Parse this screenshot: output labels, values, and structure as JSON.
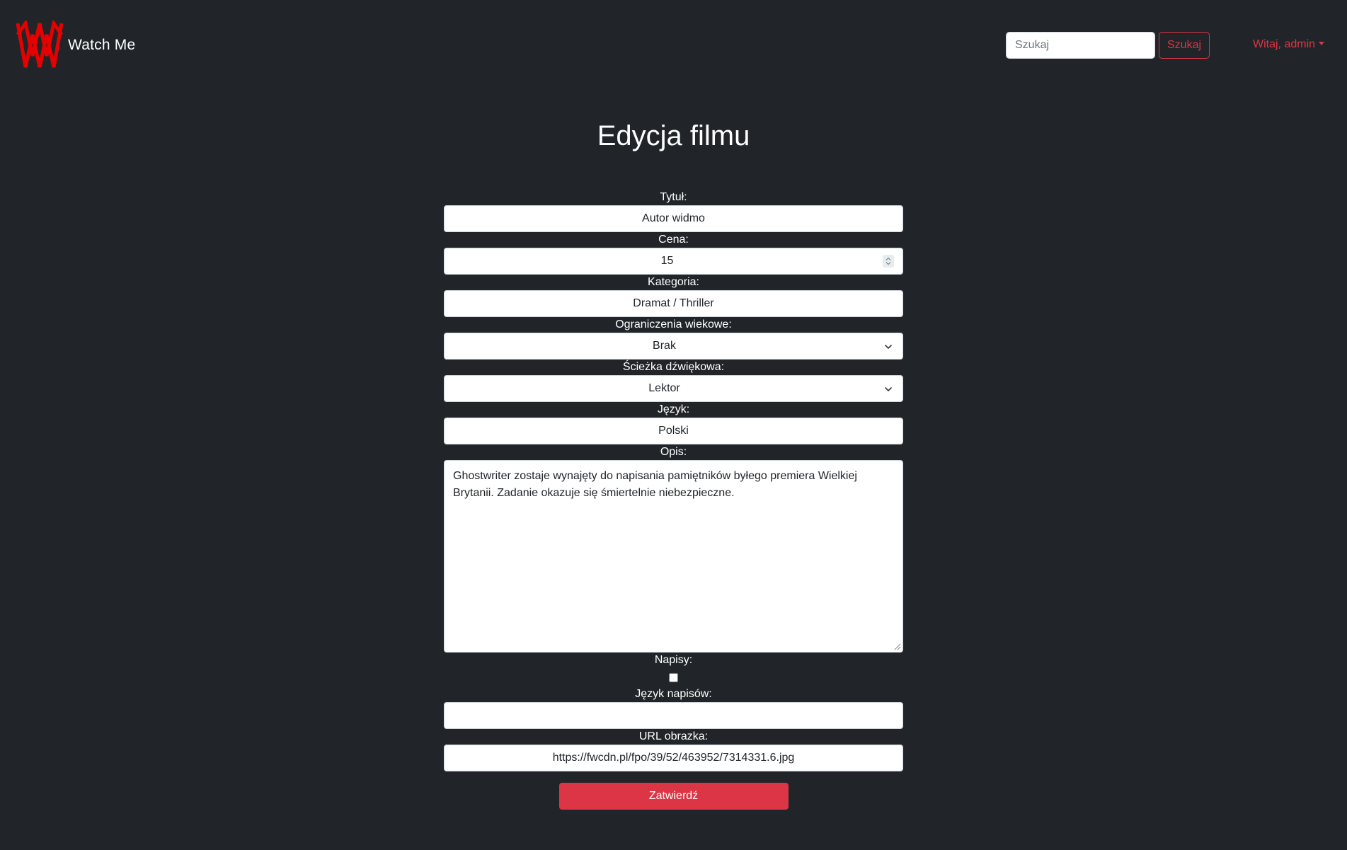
{
  "brand": {
    "name": "Watch Me",
    "logo_icon": "watch-me-logo-icon",
    "logo_color": "#e60000"
  },
  "search": {
    "placeholder": "Szukaj",
    "button_label": "Szukaj"
  },
  "user_menu": {
    "label": "Witaj, admin"
  },
  "colors": {
    "background": "#212529",
    "accent": "#dc3545",
    "text": "#ffffff"
  },
  "page": {
    "title": "Edycja filmu"
  },
  "form": {
    "title": {
      "label": "Tytuł:",
      "value": "Autor widmo"
    },
    "price": {
      "label": "Cena:",
      "value": "15"
    },
    "category": {
      "label": "Kategoria:",
      "value": "Dramat / Thriller"
    },
    "age_restriction": {
      "label": "Ograniczenia wiekowe:",
      "value": "Brak"
    },
    "soundtrack": {
      "label": "Ścieżka dźwiękowa:",
      "value": "Lektor"
    },
    "language": {
      "label": "Język:",
      "value": "Polski"
    },
    "description": {
      "label": "Opis:",
      "value": "Ghostwriter zostaje wynajęty do napisania pamiętników byłego premiera Wielkiej Brytanii. Zadanie okazuje się śmiertelnie niebezpieczne."
    },
    "subtitles": {
      "label": "Napisy:",
      "checked": false
    },
    "subtitle_language": {
      "label": "Język napisów:",
      "value": ""
    },
    "image_url": {
      "label": "URL obrazka:",
      "value": "https://fwcdn.pl/fpo/39/52/463952/7314331.6.jpg"
    },
    "submit_label": "Zatwierdź"
  }
}
